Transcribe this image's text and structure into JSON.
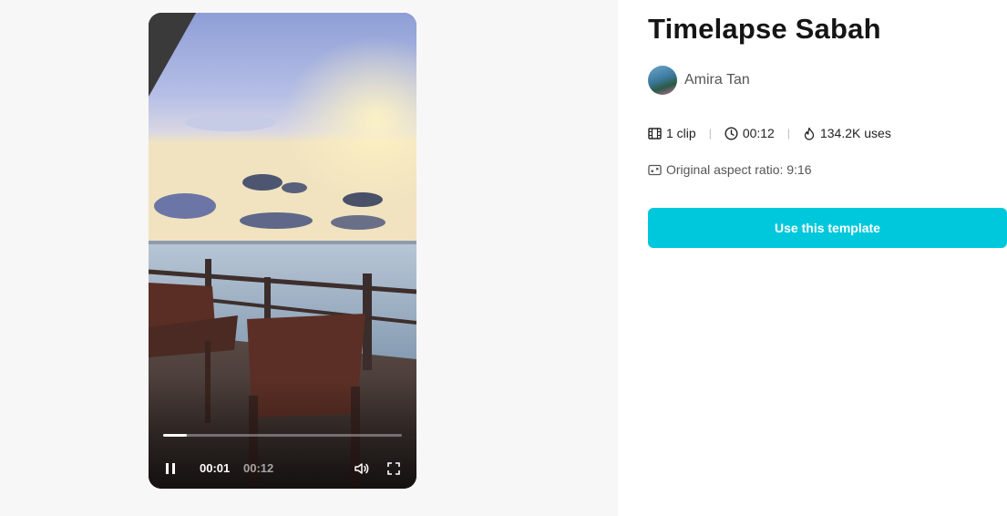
{
  "template": {
    "title": "Timelapse Sabah",
    "author": "Amira Tan",
    "clips": "1 clip",
    "duration": "00:12",
    "uses": "134.2K uses",
    "aspect_ratio": "Original aspect ratio: 9:16",
    "cta_label": "Use this template"
  },
  "player": {
    "current_time": "00:01",
    "total_time": "00:12",
    "progress_fraction": 0.1,
    "state": "playing"
  },
  "colors": {
    "accent": "#00c8dc",
    "left_background": "#f7f7f7"
  },
  "icons": {
    "clip": "film-icon",
    "duration": "clock-icon",
    "uses": "flame-icon",
    "aspect": "aspect-ratio-icon",
    "pause": "pause-icon",
    "volume": "volume-icon",
    "fullscreen": "fullscreen-icon"
  }
}
